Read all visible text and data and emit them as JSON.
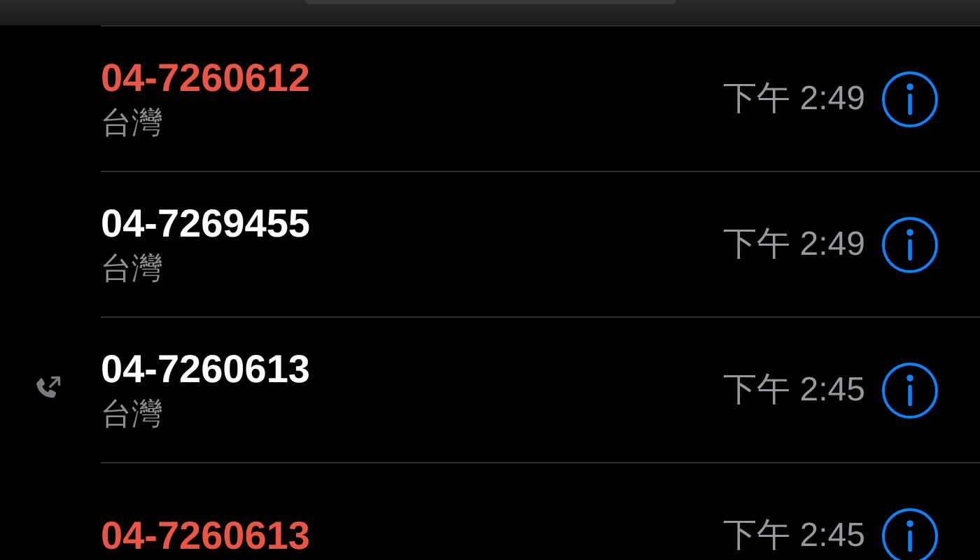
{
  "calls": [
    {
      "number": "04-7260612",
      "missed": true,
      "outgoing": false,
      "location": "台灣",
      "time": "下午 2:49"
    },
    {
      "number": "04-7269455",
      "missed": false,
      "outgoing": false,
      "location": "台灣",
      "time": "下午 2:49"
    },
    {
      "number": "04-7260613",
      "missed": false,
      "outgoing": true,
      "location": "台灣",
      "time": "下午 2:45"
    },
    {
      "number": "04-7260613",
      "missed": true,
      "outgoing": false,
      "time": "下午 2:45"
    }
  ]
}
